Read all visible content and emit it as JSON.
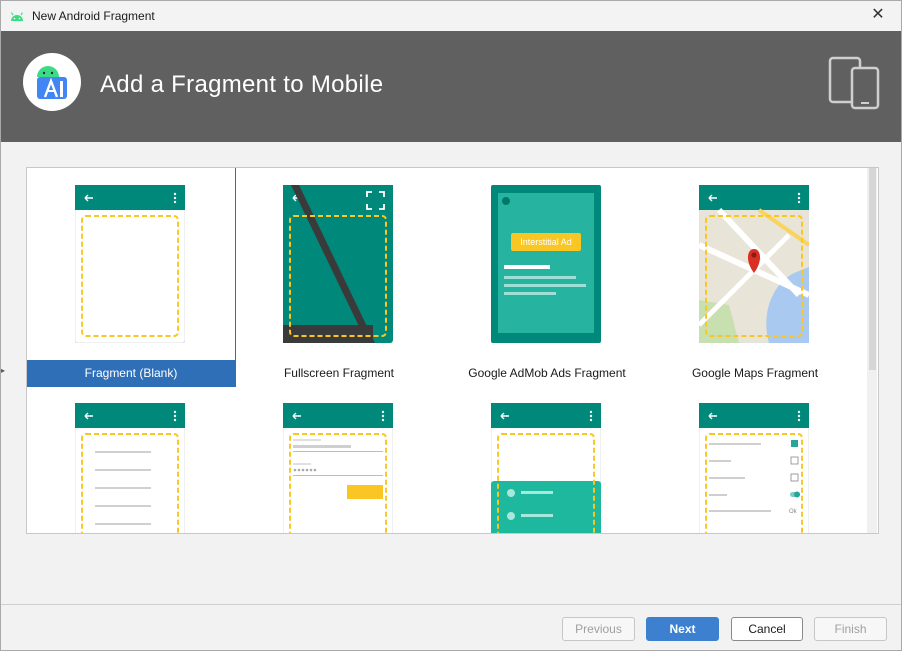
{
  "window": {
    "title": "New Android Fragment",
    "close_glyph": "✕"
  },
  "banner": {
    "heading": "Add a Fragment to Mobile"
  },
  "gallery": {
    "tiles": [
      {
        "label": "Fragment (Blank)",
        "selected": true
      },
      {
        "label": "Fullscreen Fragment",
        "selected": false
      },
      {
        "label": "Google AdMob Ads Fragment",
        "selected": false,
        "ad_label": "Interstitial Ad"
      },
      {
        "label": "Google Maps Fragment",
        "selected": false
      },
      {
        "label": "",
        "selected": false
      },
      {
        "label": "",
        "selected": false
      },
      {
        "label": "",
        "selected": false
      },
      {
        "label": "",
        "selected": false
      }
    ]
  },
  "footer": {
    "previous_label": "Previous",
    "next_label": "Next",
    "cancel_label": "Cancel",
    "finish_label": "Finish"
  },
  "colors": {
    "teal": "#00897b",
    "teal_light": "#26a69a",
    "selection": "#2f6fb8",
    "banner": "#606060",
    "dash": "#f9c623"
  }
}
